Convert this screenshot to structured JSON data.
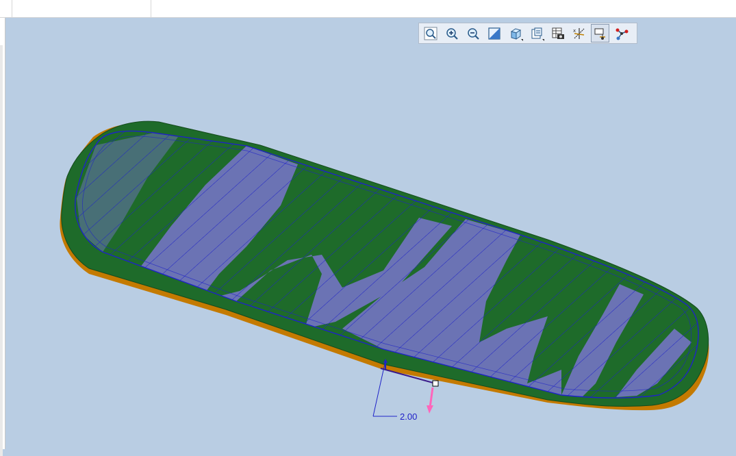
{
  "toolbar": {
    "buttons": [
      {
        "name": "zoom-fit-button",
        "icon": "magnifier-icon"
      },
      {
        "name": "zoom-in-button",
        "icon": "zoom-in-icon"
      },
      {
        "name": "zoom-out-button",
        "icon": "zoom-out-icon"
      },
      {
        "name": "refit-view-button",
        "icon": "view-diagonal-icon"
      },
      {
        "name": "display-style-button",
        "icon": "cube-icon"
      },
      {
        "name": "saved-views-button",
        "icon": "saved-views-icon"
      },
      {
        "name": "view-manager-button",
        "icon": "table-camera-icon"
      },
      {
        "name": "datum-display-button",
        "icon": "datum-axes-icon"
      },
      {
        "name": "annotation-display-button",
        "icon": "annotation-display-icon",
        "active": true
      },
      {
        "name": "spin-center-button",
        "icon": "nodes-icon"
      }
    ]
  },
  "model": {
    "surface_color": "#1e6b2a",
    "toolpath_color": "#6b73b4",
    "edge_color": "#c07800",
    "curve_color": "#1e22c8",
    "drag_handle_color": "#ff66bb"
  },
  "dimension": {
    "value": "2.00"
  }
}
